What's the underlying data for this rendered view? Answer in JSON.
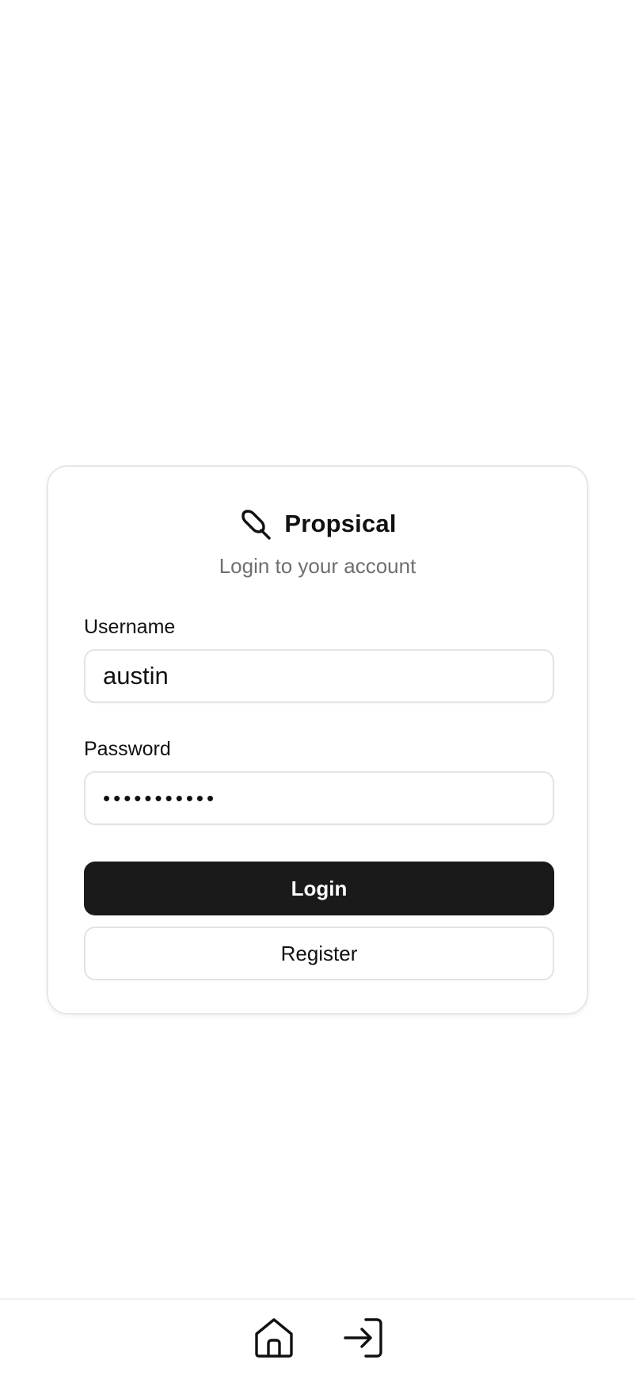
{
  "brand": {
    "name": "Propsical",
    "icon": "popsicle-icon"
  },
  "subtitle": "Login to your account",
  "form": {
    "username_label": "Username",
    "username_value": "austin",
    "password_label": "Password",
    "password_value": "•••••••••••",
    "login_label": "Login",
    "register_label": "Register"
  },
  "bottom_nav": {
    "items": [
      {
        "icon": "home-icon"
      },
      {
        "icon": "login-icon"
      }
    ]
  },
  "colors": {
    "primary_button": "#1a1a1a",
    "subtitle_text": "#6f6f6f",
    "border": "#e3e3e3"
  }
}
